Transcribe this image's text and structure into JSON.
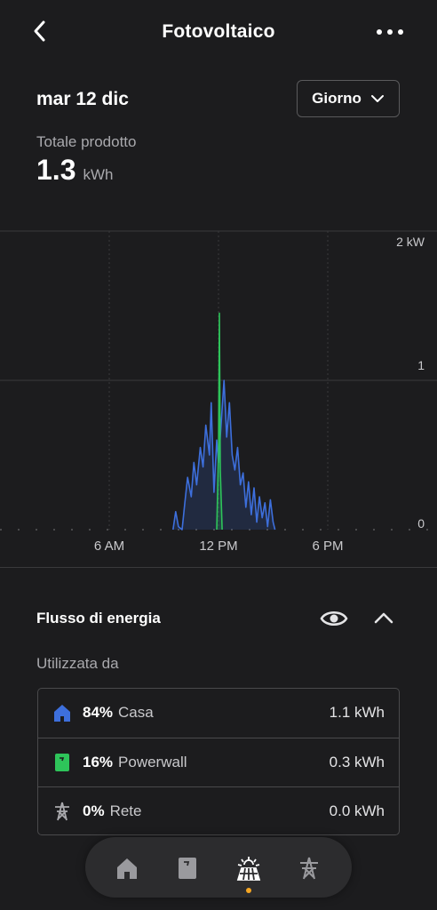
{
  "header": {
    "title": "Fotovoltaico"
  },
  "date": "mar 12 dic",
  "range": {
    "label": "Giorno"
  },
  "total": {
    "label": "Totale prodotto",
    "value": "1.3",
    "unit": "kWh"
  },
  "chart_data": {
    "type": "area",
    "y_axis_labels": [
      "2 kW",
      "1",
      "0"
    ],
    "x_axis_labels": [
      "6 AM",
      "12 PM",
      "6 PM"
    ],
    "ylim": [
      0,
      2
    ],
    "xlim_hours": [
      0,
      24
    ],
    "grid": true,
    "series": [
      {
        "color": "#3d6fdc",
        "x": [
          9.5,
          9.65,
          9.8,
          10.0,
          10.15,
          10.3,
          10.5,
          10.65,
          10.8,
          11.0,
          11.15,
          11.3,
          11.5,
          11.6,
          11.75,
          11.9,
          12.0,
          12.15,
          12.3,
          12.45,
          12.6,
          12.75,
          12.9,
          13.05,
          13.2,
          13.35,
          13.5,
          13.65,
          13.8,
          13.95,
          14.1,
          14.25,
          14.4,
          14.55,
          14.7,
          14.85,
          15.0,
          15.1
        ],
        "values": [
          0.0,
          0.12,
          0.02,
          0.0,
          0.18,
          0.35,
          0.22,
          0.45,
          0.3,
          0.55,
          0.42,
          0.7,
          0.5,
          0.85,
          0.25,
          0.6,
          0.45,
          0.72,
          1.0,
          0.62,
          0.85,
          0.5,
          0.4,
          0.55,
          0.3,
          0.38,
          0.15,
          0.32,
          0.1,
          0.28,
          0.05,
          0.22,
          0.08,
          0.18,
          0.02,
          0.2,
          0.05,
          0.0
        ]
      },
      {
        "color": "#2ec45a",
        "x": [
          11.9,
          12.0,
          12.05,
          12.1,
          12.2
        ],
        "values": [
          0.0,
          0.5,
          1.45,
          0.4,
          0.0
        ]
      }
    ]
  },
  "flow": {
    "title": "Flusso di energia",
    "used_label": "Utilizzata da",
    "rows": [
      {
        "pct": "84%",
        "name": "Casa",
        "value": "1.1 kWh",
        "icon": "house-icon",
        "color": "#3d6fdc"
      },
      {
        "pct": "16%",
        "name": "Powerwall",
        "value": "0.3 kWh",
        "icon": "powerwall-icon",
        "color": "#2ec45a"
      },
      {
        "pct": "0%",
        "name": "Rete",
        "value": "0.0 kWh",
        "icon": "grid-tower-icon",
        "color": "#a9a9ad"
      }
    ]
  },
  "nav": {
    "items": [
      "home-icon",
      "powerwall-icon",
      "solar-icon",
      "grid-tower-icon"
    ],
    "active": "solar-icon"
  }
}
